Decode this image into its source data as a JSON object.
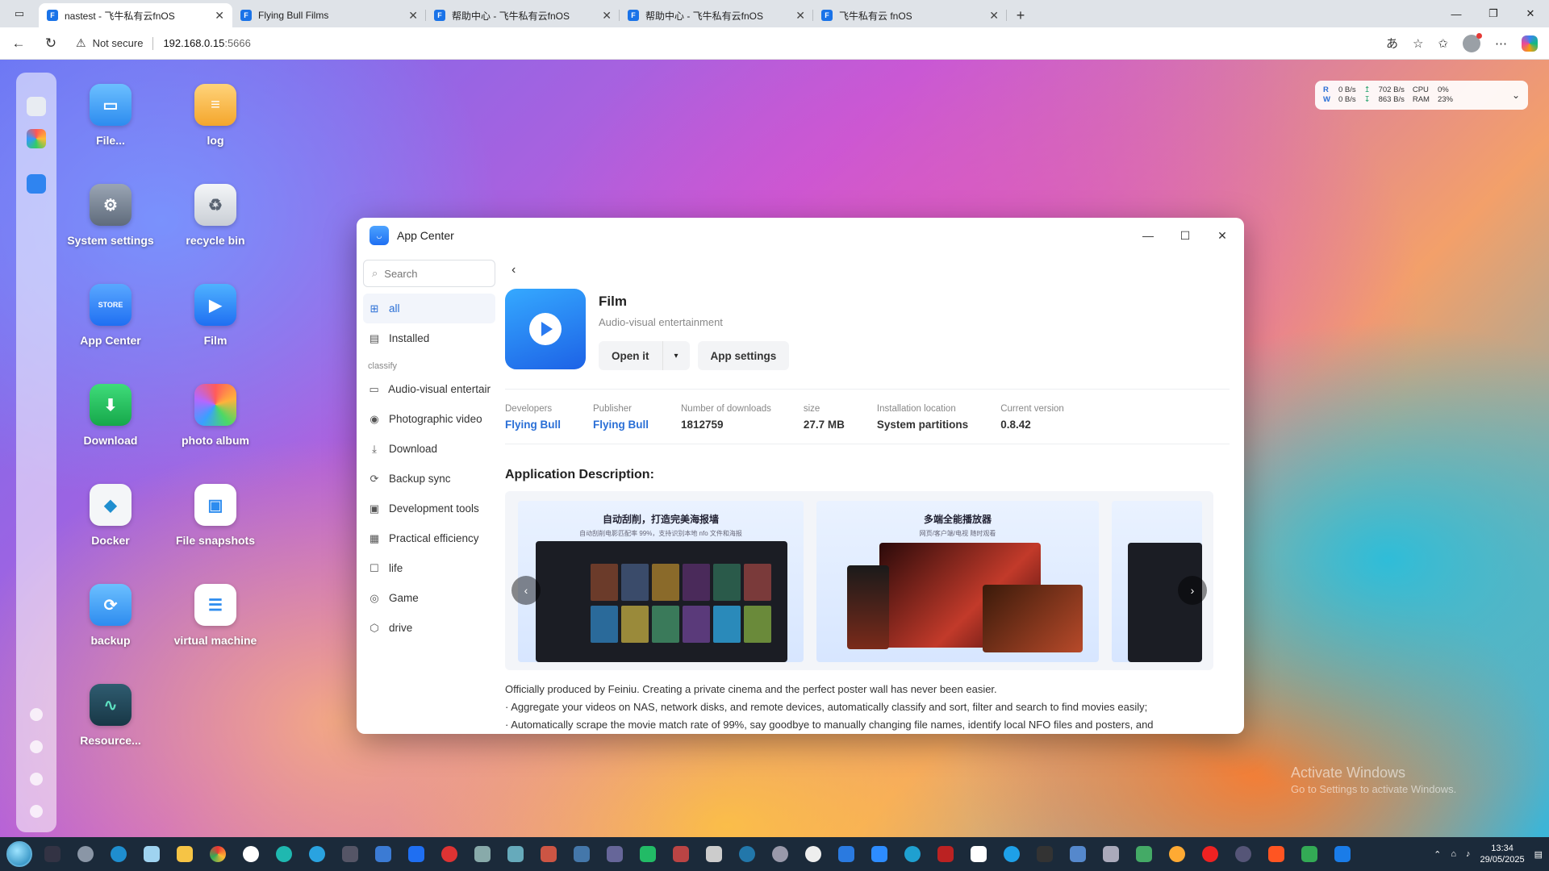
{
  "browser": {
    "tabs": [
      {
        "title": "nastest - 飞牛私有云fnOS",
        "active": true
      },
      {
        "title": "Flying Bull Films",
        "active": false
      },
      {
        "title": "帮助中心 - 飞牛私有云fnOS",
        "active": false
      },
      {
        "title": "帮助中心 - 飞牛私有云fnOS",
        "active": false
      },
      {
        "title": "飞牛私有云 fnOS",
        "active": false
      }
    ],
    "security": "Not secure",
    "host": "192.168.0.15",
    "port": ":5666"
  },
  "desktop": {
    "icons": [
      {
        "label": "File...",
        "color": "#4aa3f5",
        "icon": "folder-icon"
      },
      {
        "label": "log",
        "color": "#f7b84a",
        "icon": "log-icon"
      },
      {
        "label": "System settings",
        "color": "#7c8796",
        "icon": "gear-icon"
      },
      {
        "label": "recycle bin",
        "color": "#cfd4da",
        "icon": "recycle-icon"
      },
      {
        "label": "App Center",
        "color": "#2f84f0",
        "icon": "store-icon"
      },
      {
        "label": "Film",
        "color": "#2a86f2",
        "icon": "film-icon"
      },
      {
        "label": "Download",
        "color": "#22c25a",
        "icon": "download-icon"
      },
      {
        "label": "photo album",
        "color": "#f2f2f2",
        "icon": "photo-icon"
      },
      {
        "label": "Docker",
        "color": "#f2f2f2",
        "icon": "docker-icon"
      },
      {
        "label": "File snapshots",
        "color": "#ffffff",
        "icon": "snapshot-icon"
      },
      {
        "label": "backup",
        "color": "#3aa0f0",
        "icon": "backup-icon"
      },
      {
        "label": "virtual machine",
        "color": "#ffffff",
        "icon": "vm-icon"
      },
      {
        "label": "Resource...",
        "color": "#244a5e",
        "icon": "monitor-icon"
      }
    ],
    "monitor": {
      "r_label": "R",
      "w_label": "W",
      "r_disk": "0",
      "w_disk": "0",
      "unit": "B/s",
      "up_net": "702",
      "down_net": "863",
      "cpu_label": "CPU",
      "ram_label": "RAM",
      "cpu": "0%",
      "ram": "23%"
    },
    "watermark": {
      "line1": "Activate Windows",
      "line2": "Go to Settings to activate Windows."
    }
  },
  "app_center": {
    "title": "App Center",
    "search_placeholder": "Search",
    "nav_top": [
      {
        "label": "all",
        "icon": "grid-icon",
        "active": true
      },
      {
        "label": "Installed",
        "icon": "installed-icon",
        "active": false
      }
    ],
    "classify_label": "classify",
    "categories": [
      {
        "label": "Audio-visual entertair",
        "icon": "video-icon"
      },
      {
        "label": "Photographic video",
        "icon": "camera-icon"
      },
      {
        "label": "Download",
        "icon": "download-icon"
      },
      {
        "label": "Backup sync",
        "icon": "sync-icon"
      },
      {
        "label": "Development tools",
        "icon": "code-icon"
      },
      {
        "label": "Practical efficiency",
        "icon": "tool-icon"
      },
      {
        "label": "life",
        "icon": "life-icon"
      },
      {
        "label": "Game",
        "icon": "game-icon"
      },
      {
        "label": "drive",
        "icon": "drive-icon"
      }
    ],
    "app": {
      "name": "Film",
      "category": "Audio-visual entertainment",
      "open_label": "Open it",
      "settings_label": "App settings",
      "meta": [
        {
          "key": "Developers",
          "value": "Flying Bull",
          "link": true
        },
        {
          "key": "Publisher",
          "value": "Flying Bull",
          "link": true
        },
        {
          "key": "Number of downloads",
          "value": "1812759",
          "link": false
        },
        {
          "key": "size",
          "value": "27.7 MB",
          "link": false
        },
        {
          "key": "Installation location",
          "value": "System partitions",
          "link": false
        },
        {
          "key": "Current version",
          "value": "0.8.42",
          "link": false
        }
      ],
      "description_title": "Application Description:",
      "screenshots": [
        {
          "caption": "自动刮削，打造完美海报墙",
          "sub": "自动刮削电影匹配率 99%，支持识别本地 nfo 文件和海报"
        },
        {
          "caption": "多端全能播放器",
          "sub": "网页/客户端/电视 随时观看"
        },
        {
          "caption": "",
          "sub": ""
        }
      ],
      "description_lines": [
        "Officially produced by Feiniu. Creating a private cinema and the perfect poster wall has never been easier.",
        "· Aggregate your videos on NAS, network disks, and remote devices, automatically classify and sort, filter and search to find movies easily;",
        "· Automatically scrape the movie match rate of 99%, say goodbye to manually changing file names, identify local NFO files and posters, and"
      ]
    }
  },
  "taskbar": {
    "time": "13:34",
    "date": "29/05/2025"
  }
}
